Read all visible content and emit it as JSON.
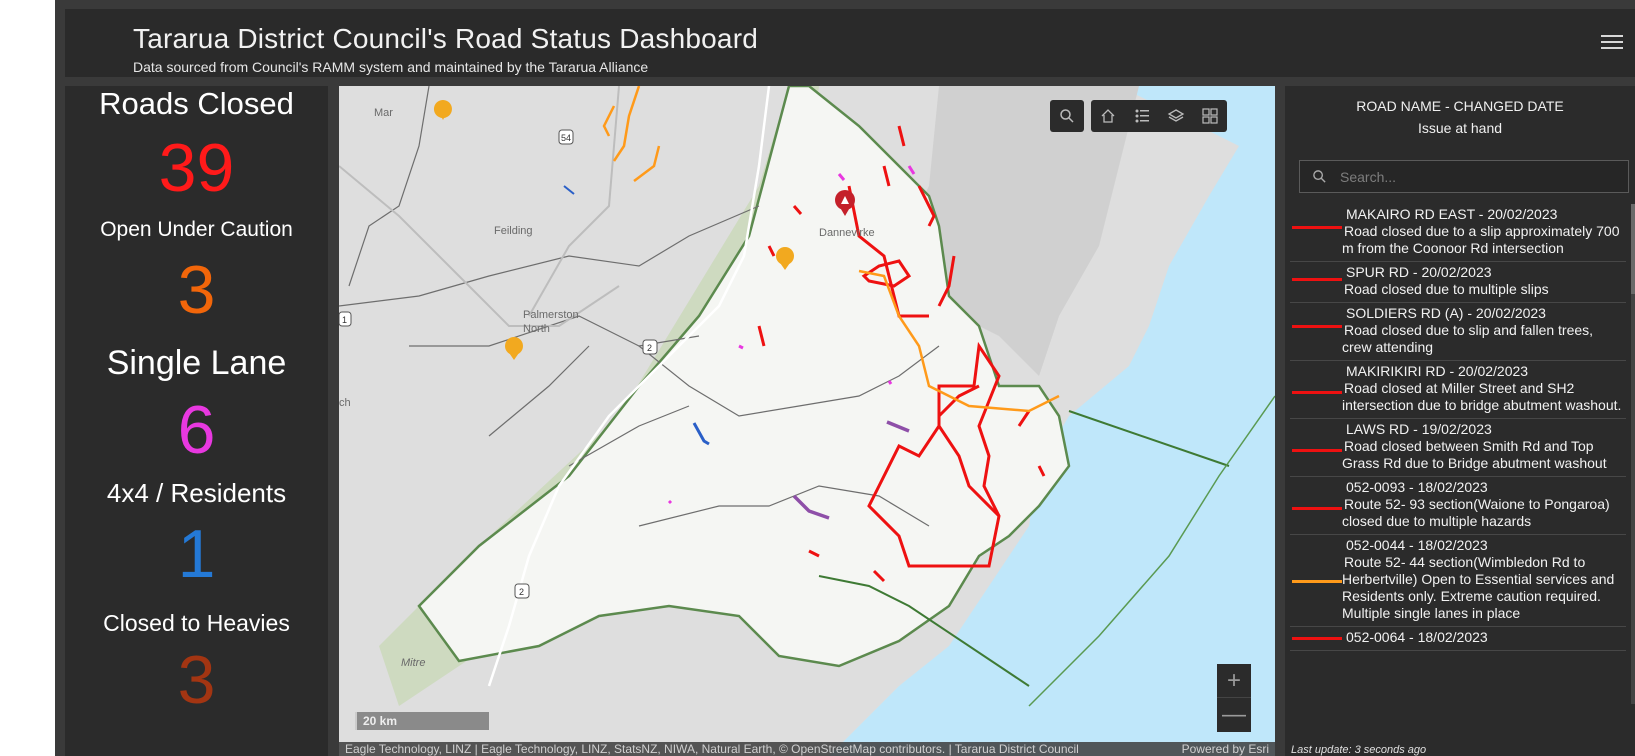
{
  "header": {
    "title": "Tararua District Council's Road Status Dashboard",
    "subtitle": "Data sourced from Council's RAMM system and maintained by the Tararua Alliance",
    "menu_icon": "hamburger-menu-icon"
  },
  "stats": [
    {
      "label": "Roads Closed",
      "value": "39",
      "color": "#ff1a1a"
    },
    {
      "label": "Open Under Caution",
      "value": "3",
      "color": "#f2660a"
    },
    {
      "label": "Single Lane",
      "value": "6",
      "color": "#e838e0"
    },
    {
      "label": "4x4 / Residents",
      "value": "1",
      "color": "#2479d6"
    },
    {
      "label": "Closed to Heavies",
      "value": "3",
      "color": "#a33512"
    }
  ],
  "map": {
    "place_labels": [
      "Mar",
      "Feilding",
      "Palmerston North",
      "Dannevirke",
      "ch",
      "Mitre"
    ],
    "route_shields": [
      "54",
      "1",
      "2",
      "2"
    ],
    "toolbar": [
      "search-icon",
      "home-icon",
      "legend-icon",
      "layers-icon",
      "basemap-gallery-icon"
    ],
    "zoom_in": "+",
    "zoom_out": "—",
    "scale": "20 km",
    "attribution": "Eagle Technology, LINZ | Eagle Technology, LINZ, StatsNZ, NIWA, Natural Earth, © OpenStreetMap contributors. | Tararua District Council",
    "powered_by": "Powered by Esri"
  },
  "list": {
    "header_line1": "ROAD NAME - CHANGED DATE",
    "header_line2": "Issue at hand",
    "search_placeholder": "Search...",
    "items": [
      {
        "name": "MAKAIRO RD EAST - 20/02/2023",
        "desc": "Road closed due to a slip approximately 700 m from the Coonoor Rd intersection",
        "color": "#ee1111"
      },
      {
        "name": "SPUR RD - 20/02/2023",
        "desc": "Road closed due to multiple slips",
        "color": "#ee1111"
      },
      {
        "name": "SOLDIERS RD (A) - 20/02/2023",
        "desc": "Road closed due to slip and fallen trees, crew attending",
        "color": "#ee1111"
      },
      {
        "name": "MAKIRIKIRI RD - 20/02/2023",
        "desc": "Road closed at Miller Street and SH2 intersection due to bridge abutment washout.",
        "color": "#ee1111"
      },
      {
        "name": "LAWS RD - 19/02/2023",
        "desc": "Road closed between Smith Rd and Top Grass Rd due to Bridge abutment washout",
        "color": "#ee1111"
      },
      {
        "name": "052-0093 - 18/02/2023",
        "desc": "Route 52- 93 section(Waione to Pongaroa) closed due to multiple hazards",
        "color": "#ee1111"
      },
      {
        "name": "052-0044 - 18/02/2023",
        "desc": "Route 52- 44 section(Wimbledon Rd to Herbertville) Open to Essential services and Residents only. Extreme caution required. Multiple single lanes in place",
        "color": "#ff9a1a"
      },
      {
        "name": "052-0064 - 18/02/2023",
        "desc": "",
        "color": "#ee1111"
      }
    ],
    "last_update": "Last update: 3 seconds ago"
  }
}
